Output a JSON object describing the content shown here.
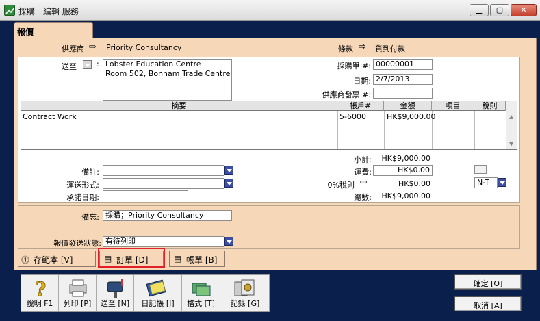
{
  "window": {
    "title": "採購 - 編輯 服務"
  },
  "tab": {
    "label": "報價"
  },
  "header": {
    "supplier_label": "供應商",
    "supplier_value": "Priority Consultancy",
    "terms_label": "條款",
    "terms_value": "貨到付款"
  },
  "ship_to": {
    "label": "送至",
    "address_line1": "Lobster Education Centre",
    "address_line2": "Room 502, Bonham Trade Centre"
  },
  "order": {
    "po_label": "採購單 #:",
    "po_value": "00000001",
    "date_label": "日期:",
    "date_value": "2/7/2013",
    "invoice_label": "供應商發票 #:",
    "invoice_value": ""
  },
  "grid": {
    "columns": [
      "摘要",
      "帳戶#",
      "金額",
      "項目",
      "稅則"
    ],
    "rows": [
      {
        "description": "Contract Work",
        "account": "5-6000",
        "amount": "HK$9,000.00",
        "job": "",
        "tax": ""
      }
    ]
  },
  "totals": {
    "subtotal_label": "小計:",
    "subtotal_value": "HK$9,000.00",
    "freight_label": "運費:",
    "freight_value": "HK$0.00",
    "tax_label": "0%稅則",
    "tax_value": "HK$0.00",
    "total_label": "總數:",
    "total_value": "HK$9,000.00",
    "tax_code": "N-T"
  },
  "fields": {
    "comment_label": "備註:",
    "ship_via_label": "運送形式:",
    "promised_label": "承諾日期:",
    "memo_label": "備忘:",
    "memo_value": "採購；Priority Consultancy",
    "status_label": "報價發送狀態:",
    "status_value": "有待列印"
  },
  "actions": {
    "save_template": "存範本 [V]",
    "order": "訂單 [D]",
    "bill": "帳單 [B]"
  },
  "toolbar": {
    "help": "說明 F1",
    "print": "列印 [P]",
    "send": "送至 [N]",
    "journal": "日記帳 [J]",
    "format": "格式 [T]",
    "record": "記錄 [G]"
  },
  "dialog": {
    "ok": "確定 [O]",
    "cancel": "取消 [A]"
  },
  "colors": {
    "panel": "#f6d7b7",
    "highlight": "#e0202a",
    "window_bg": "#0b1f4c"
  }
}
